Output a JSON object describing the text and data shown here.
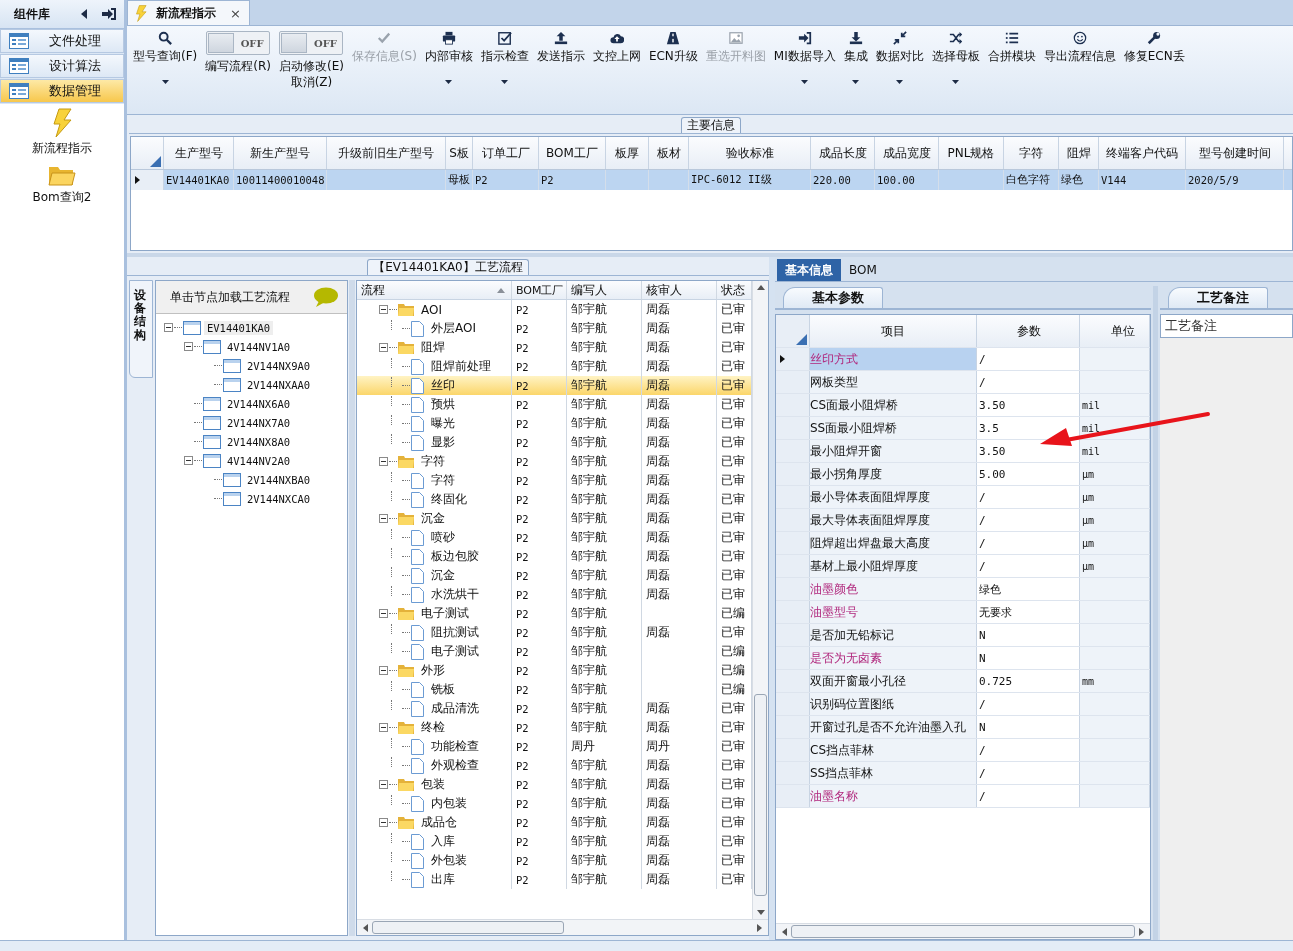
{
  "sidebar": {
    "title": "组件库",
    "items": [
      {
        "label": "文件处理",
        "selected": false
      },
      {
        "label": "设计算法",
        "selected": false
      },
      {
        "label": "数据管理",
        "selected": true
      }
    ],
    "shortcuts": [
      {
        "label": "新流程指示"
      },
      {
        "label": "Bom查询2"
      }
    ]
  },
  "tab": {
    "label": "新流程指示",
    "close": "×"
  },
  "toolbar": [
    {
      "kind": "button",
      "label": "型号查询(F)",
      "dropdown": true,
      "disabled": false
    },
    {
      "kind": "toggle",
      "toggle_text": "OFF",
      "on": false,
      "label": "编写流程(R)"
    },
    {
      "kind": "toggle",
      "toggle_text": "OFF",
      "on": false,
      "label": "启动修改(E)",
      "label2": "取消(Z)"
    },
    {
      "kind": "button",
      "label": "保存信息(S)",
      "dropdown": false,
      "disabled": true
    },
    {
      "kind": "button",
      "label": "内部审核",
      "dropdown": true,
      "disabled": false
    },
    {
      "kind": "button",
      "label": "指示检查",
      "dropdown": true,
      "disabled": false
    },
    {
      "kind": "button",
      "label": "发送指示",
      "dropdown": false,
      "disabled": false
    },
    {
      "kind": "button",
      "label": "文控上网",
      "dropdown": false,
      "disabled": false
    },
    {
      "kind": "button",
      "label": "ECN升级",
      "dropdown": false,
      "disabled": false
    },
    {
      "kind": "button",
      "label": "重选开料图",
      "dropdown": false,
      "disabled": true
    },
    {
      "kind": "button",
      "label": "MI数据导入",
      "dropdown": true,
      "disabled": false
    },
    {
      "kind": "button",
      "label": "集成",
      "dropdown": true,
      "disabled": false
    },
    {
      "kind": "button",
      "label": "数据对比",
      "dropdown": true,
      "disabled": false
    },
    {
      "kind": "button",
      "label": "选择母板",
      "dropdown": true,
      "disabled": false
    },
    {
      "kind": "button",
      "label": "合拼模块",
      "dropdown": false,
      "disabled": false
    },
    {
      "kind": "button",
      "label": "导出流程信息",
      "dropdown": false,
      "disabled": false
    },
    {
      "kind": "button",
      "label": "修复ECN丢",
      "dropdown": false,
      "disabled": false
    }
  ],
  "main_info": {
    "title": "主要信息",
    "columns": [
      "生产型号",
      "新生产型号",
      "升级前旧生产型号",
      "S板",
      "订单工厂",
      "BOM工厂",
      "板厚",
      "板材",
      "验收标准",
      "成品长度",
      "成品宽度",
      "PNL规格",
      "字符",
      "阻焊",
      "终端客户代码",
      "型号创建时间"
    ],
    "rows": [
      {
        "selected": true,
        "cells": [
          "EV14401KA0",
          "10011400010048",
          null,
          "母板",
          "P2",
          "P2",
          null,
          null,
          "IPC-6012 II级",
          "220.00",
          "100.00",
          null,
          "白色字符",
          "绿色",
          "V144",
          "2020/5/9"
        ]
      }
    ]
  },
  "flow": {
    "title": "【EV14401KA0】工艺流程",
    "side_tab": "设备结构",
    "tree_hint": "单击节点加载工艺流程",
    "tree": {
      "label": "EV14401KA0",
      "selected": true,
      "expanded": true,
      "children": [
        {
          "label": "4V144NV1A0",
          "selected": false,
          "expanded": true,
          "children": [
            {
              "label": "2V144NX9A0",
              "selected": false
            },
            {
              "label": "2V144NXAA0",
              "selected": false
            }
          ]
        },
        {
          "label": "2V144NX6A0",
          "selected": false
        },
        {
          "label": "2V144NX7A0",
          "selected": false
        },
        {
          "label": "2V144NX8A0",
          "selected": false
        },
        {
          "label": "4V144NV2A0",
          "selected": false,
          "expanded": true,
          "children": [
            {
              "label": "2V144NXBA0",
              "selected": false
            },
            {
              "label": "2V144NXCA0",
              "selected": false
            }
          ]
        }
      ]
    },
    "columns": [
      "流程",
      "BOM工厂",
      "编写人",
      "核审人",
      "状态"
    ],
    "rows": [
      {
        "name": "AOI",
        "factory": "P2",
        "author": "邹宇航",
        "reviewer": "周磊",
        "status": "已审",
        "selected": false,
        "expanded": true,
        "children": [
          {
            "name": "外层AOI",
            "factory": "P2",
            "author": "邹宇航",
            "reviewer": "周磊",
            "status": "已审",
            "selected": false
          }
        ]
      },
      {
        "name": "阻焊",
        "factory": "P2",
        "author": "邹宇航",
        "reviewer": "周磊",
        "status": "已审",
        "selected": false,
        "expanded": true,
        "children": [
          {
            "name": "阻焊前处理",
            "factory": "P2",
            "author": "邹宇航",
            "reviewer": "周磊",
            "status": "已审",
            "selected": false
          },
          {
            "name": "丝印",
            "factory": "P2",
            "author": "邹宇航",
            "reviewer": "周磊",
            "status": "已审",
            "selected": true
          },
          {
            "name": "预烘",
            "factory": "P2",
            "author": "邹宇航",
            "reviewer": "周磊",
            "status": "已审",
            "selected": false
          },
          {
            "name": "曝光",
            "factory": "P2",
            "author": "邹宇航",
            "reviewer": "周磊",
            "status": "已审",
            "selected": false
          },
          {
            "name": "显影",
            "factory": "P2",
            "author": "邹宇航",
            "reviewer": "周磊",
            "status": "已审",
            "selected": false
          }
        ]
      },
      {
        "name": "字符",
        "factory": "P2",
        "author": "邹宇航",
        "reviewer": "周磊",
        "status": "已审",
        "selected": false,
        "expanded": true,
        "children": [
          {
            "name": "字符",
            "factory": "P2",
            "author": "邹宇航",
            "reviewer": "周磊",
            "status": "已审",
            "selected": false
          },
          {
            "name": "终固化",
            "factory": "P2",
            "author": "邹宇航",
            "reviewer": "周磊",
            "status": "已审",
            "selected": false
          }
        ]
      },
      {
        "name": "沉金",
        "factory": "P2",
        "author": "邹宇航",
        "reviewer": "周磊",
        "status": "已审",
        "selected": false,
        "expanded": true,
        "children": [
          {
            "name": "喷砂",
            "factory": "P2",
            "author": "邹宇航",
            "reviewer": "周磊",
            "status": "已审",
            "selected": false
          },
          {
            "name": "板边包胶",
            "factory": "P2",
            "author": "邹宇航",
            "reviewer": "周磊",
            "status": "已审",
            "selected": false
          },
          {
            "name": "沉金",
            "factory": "P2",
            "author": "邹宇航",
            "reviewer": "周磊",
            "status": "已审",
            "selected": false
          },
          {
            "name": "水洗烘干",
            "factory": "P2",
            "author": "邹宇航",
            "reviewer": "周磊",
            "status": "已审",
            "selected": false
          }
        ]
      },
      {
        "name": "电子测试",
        "factory": "P2",
        "author": "邹宇航",
        "status": "已编",
        "selected": false,
        "expanded": true,
        "children": [
          {
            "name": "阻抗测试",
            "factory": "P2",
            "author": "邹宇航",
            "reviewer": "周磊",
            "status": "已审",
            "selected": false
          },
          {
            "name": "电子测试",
            "factory": "P2",
            "author": "邹宇航",
            "status": "已编",
            "selected": false
          }
        ]
      },
      {
        "name": "外形",
        "factory": "P2",
        "author": "邹宇航",
        "status": "已编",
        "selected": false,
        "expanded": true,
        "children": [
          {
            "name": "铣板",
            "factory": "P2",
            "author": "邹宇航",
            "status": "已编",
            "selected": false
          },
          {
            "name": "成品清洗",
            "factory": "P2",
            "author": "邹宇航",
            "reviewer": "周磊",
            "status": "已审",
            "selected": false
          }
        ]
      },
      {
        "name": "终检",
        "factory": "P2",
        "author": "邹宇航",
        "reviewer": "周磊",
        "status": "已审",
        "selected": false,
        "expanded": true,
        "children": [
          {
            "name": "功能检查",
            "factory": "P2",
            "author": "周丹",
            "reviewer": "周丹",
            "status": "已审",
            "selected": false
          },
          {
            "name": "外观检查",
            "factory": "P2",
            "author": "邹宇航",
            "reviewer": "周磊",
            "status": "已审",
            "selected": false
          }
        ]
      },
      {
        "name": "包装",
        "factory": "P2",
        "author": "邹宇航",
        "reviewer": "周磊",
        "status": "已审",
        "selected": false,
        "expanded": true,
        "children": [
          {
            "name": "内包装",
            "factory": "P2",
            "author": "邹宇航",
            "reviewer": "周磊",
            "status": "已审",
            "selected": false
          }
        ]
      },
      {
        "name": "成品仓",
        "factory": "P2",
        "author": "邹宇航",
        "reviewer": "周磊",
        "status": "已审",
        "selected": false,
        "expanded": true,
        "children": [
          {
            "name": "入库",
            "factory": "P2",
            "author": "邹宇航",
            "reviewer": "周磊",
            "status": "已审",
            "selected": false
          },
          {
            "name": "外包装",
            "factory": "P2",
            "author": "邹宇航",
            "reviewer": "周磊",
            "status": "已审",
            "selected": false
          },
          {
            "name": "出库",
            "factory": "P2",
            "author": "邹宇航",
            "reviewer": "周磊",
            "status": "已审",
            "selected": false
          }
        ]
      }
    ]
  },
  "details": {
    "tabs": [
      {
        "label": "基本信息",
        "selected": true
      },
      {
        "label": "BOM",
        "selected": false
      }
    ],
    "sub_tab": "基本参数",
    "columns": [
      "项目",
      "参数",
      "单位"
    ],
    "rows": [
      {
        "item": "丝印方式",
        "value": "/",
        "highlighted": true,
        "selected": true
      },
      {
        "item": "网板类型",
        "value": "/",
        "highlighted": false,
        "selected": false
      },
      {
        "item": "CS面最小阻焊桥",
        "value": "3.50",
        "unit": "mil",
        "highlighted": false,
        "selected": false
      },
      {
        "item": "SS面最小阻焊桥",
        "value": "3.5",
        "unit": "mil",
        "highlighted": false,
        "selected": false
      },
      {
        "item": "最小阻焊开窗",
        "value": "3.50",
        "unit": "mil",
        "highlighted": false,
        "selected": false
      },
      {
        "item": "最小拐角厚度",
        "value": "5.00",
        "unit": "µm",
        "highlighted": false,
        "selected": false
      },
      {
        "item": "最小导体表面阻焊厚度",
        "value": "/",
        "unit": "µm",
        "highlighted": false,
        "selected": false
      },
      {
        "item": "最大导体表面阻焊厚度",
        "value": "/",
        "unit": "µm",
        "highlighted": false,
        "selected": false
      },
      {
        "item": "阻焊超出焊盘最大高度",
        "value": "/",
        "unit": "µm",
        "highlighted": false,
        "selected": false
      },
      {
        "item": "基材上最小阻焊厚度",
        "value": "/",
        "unit": "µm",
        "highlighted": false,
        "selected": false
      },
      {
        "item": "油墨颜色",
        "value": "绿色",
        "highlighted": true,
        "selected": false
      },
      {
        "item": "油墨型号",
        "value": "无要求",
        "highlighted": true,
        "selected": false
      },
      {
        "item": "是否加无铅标记",
        "value": "N",
        "highlighted": false,
        "selected": false
      },
      {
        "item": "是否为无卤素",
        "value": "N",
        "highlighted": true,
        "selected": false
      },
      {
        "item": "双面开窗最小孔径",
        "value": "0.725",
        "unit": "mm",
        "highlighted": false,
        "selected": false
      },
      {
        "item": "识别码位置图纸",
        "value": "/",
        "highlighted": false,
        "selected": false
      },
      {
        "item": "开窗过孔是否不允许油墨入孔",
        "value": "N",
        "highlighted": false,
        "selected": false
      },
      {
        "item": "CS挡点菲林",
        "value": "/",
        "highlighted": false,
        "selected": false
      },
      {
        "item": "SS挡点菲林",
        "value": "/",
        "highlighted": false,
        "selected": false
      },
      {
        "item": "油墨名称",
        "value": "/",
        "highlighted": true,
        "selected": false
      }
    ]
  },
  "notes": {
    "tab": "工艺备注",
    "header": "工艺备注"
  }
}
